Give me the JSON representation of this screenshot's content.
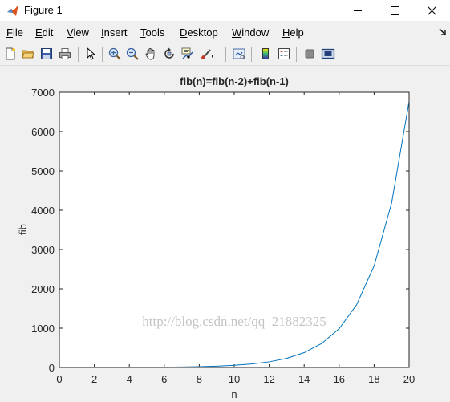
{
  "window": {
    "title": "Figure 1",
    "icons": {
      "app": "matlab-logo-icon",
      "minimize": "minimize-icon",
      "maximize": "maximize-icon",
      "close": "close-icon"
    }
  },
  "menu": {
    "items": [
      {
        "label": "File",
        "accel": "F",
        "rest": "ile"
      },
      {
        "label": "Edit",
        "accel": "E",
        "rest": "dit"
      },
      {
        "label": "View",
        "accel": "V",
        "rest": "iew"
      },
      {
        "label": "Insert",
        "accel": "I",
        "rest": "nsert"
      },
      {
        "label": "Tools",
        "accel": "T",
        "rest": "ools"
      },
      {
        "label": "Desktop",
        "accel": "D",
        "rest": "esktop"
      },
      {
        "label": "Window",
        "accel": "W",
        "rest": "indow"
      },
      {
        "label": "Help",
        "accel": "H",
        "rest": "elp"
      }
    ],
    "dock_icon": "dock-arrow-icon"
  },
  "toolbar": {
    "buttons": [
      "new-figure-icon",
      "open-file-icon",
      "save-icon",
      "print-icon",
      "edit-plot-arrow-icon",
      "zoom-in-icon",
      "zoom-out-icon",
      "pan-hand-icon",
      "rotate-3d-icon",
      "data-cursor-icon",
      "brush-icon",
      "link-plot-icon",
      "colorbar-icon",
      "legend-icon",
      "hide-plot-tools-icon",
      "show-plot-tools-icon"
    ]
  },
  "watermark": "http://blog.csdn.net/qq_21882325",
  "chart_data": {
    "type": "line",
    "title": "fib(n)=fib(n-2)+fib(n-1)",
    "xlabel": "n",
    "ylabel": "fib",
    "xlim": [
      0,
      20
    ],
    "ylim": [
      0,
      7000
    ],
    "xticks": [
      "0",
      "2",
      "4",
      "6",
      "8",
      "10",
      "12",
      "14",
      "16",
      "18",
      "20"
    ],
    "yticks": [
      "0",
      "1000",
      "2000",
      "3000",
      "4000",
      "5000",
      "6000",
      "7000"
    ],
    "grid": false,
    "line_color": "#0072bd",
    "x": [
      1,
      2,
      3,
      4,
      5,
      6,
      7,
      8,
      9,
      10,
      11,
      12,
      13,
      14,
      15,
      16,
      17,
      18,
      19,
      20
    ],
    "y": [
      1,
      1,
      2,
      3,
      5,
      8,
      13,
      21,
      34,
      55,
      89,
      144,
      233,
      377,
      610,
      987,
      1597,
      2584,
      4181,
      6765
    ]
  }
}
